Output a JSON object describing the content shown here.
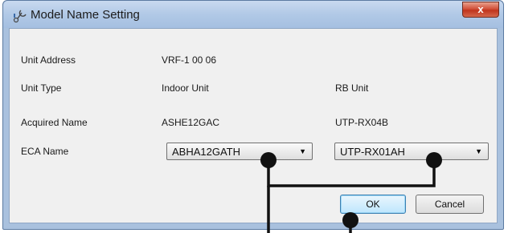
{
  "window": {
    "title": "Model Name Setting",
    "close_label": "x"
  },
  "rows": {
    "unit_address": {
      "label": "Unit Address",
      "value": "VRF-1 00 06"
    },
    "unit_type": {
      "label": "Unit Type",
      "indoor": "Indoor Unit",
      "rb": "RB Unit"
    },
    "acquired_name": {
      "label": "Acquired Name",
      "indoor": "ASHE12GAC",
      "rb": "UTP-RX04B"
    },
    "eca_name": {
      "label": "ECA Name",
      "indoor": "ABHA12GATH",
      "rb": "UTP-RX01AH"
    }
  },
  "buttons": {
    "ok": "OK",
    "cancel": "Cancel"
  },
  "icons": {
    "app": "network-settings-icon",
    "close": "close-icon",
    "dropdown": "chevron-down-icon"
  }
}
